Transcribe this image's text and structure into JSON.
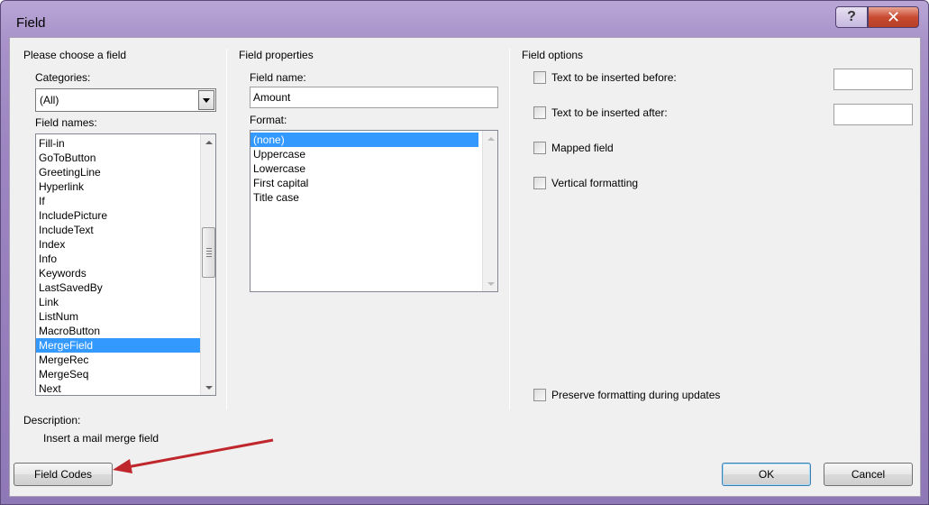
{
  "window": {
    "title": "Field",
    "help_glyph": "?",
    "close_glyph": "✕"
  },
  "choose": {
    "group_title": "Please choose a field",
    "categories_label": "Categories:",
    "categories_value": "(All)",
    "field_names_label": "Field names:",
    "field_names": [
      "Fill-in",
      "GoToButton",
      "GreetingLine",
      "Hyperlink",
      "If",
      "IncludePicture",
      "IncludeText",
      "Index",
      "Info",
      "Keywords",
      "LastSavedBy",
      "Link",
      "ListNum",
      "MacroButton",
      "MergeField",
      "MergeRec",
      "MergeSeq",
      "Next"
    ],
    "selected_field": "MergeField"
  },
  "properties": {
    "group_title": "Field properties",
    "field_name_label": "Field name:",
    "field_name_value": "Amount",
    "format_label": "Format:",
    "formats": [
      "(none)",
      "Uppercase",
      "Lowercase",
      "First capital",
      "Title case"
    ],
    "selected_format": "(none)"
  },
  "options": {
    "group_title": "Field options",
    "before_label": "Text to be inserted before:",
    "after_label": "Text to be inserted after:",
    "mapped_label": "Mapped field",
    "vertical_label": "Vertical formatting",
    "preserve_label": "Preserve formatting during updates"
  },
  "description": {
    "label": "Description:",
    "text": "Insert a mail merge field"
  },
  "buttons": {
    "field_codes": "Field Codes",
    "ok": "OK",
    "cancel": "Cancel"
  },
  "colors": {
    "selection": "#3399ff",
    "annotation_arrow": "#c0272d",
    "titlebar": "#a892c9"
  }
}
